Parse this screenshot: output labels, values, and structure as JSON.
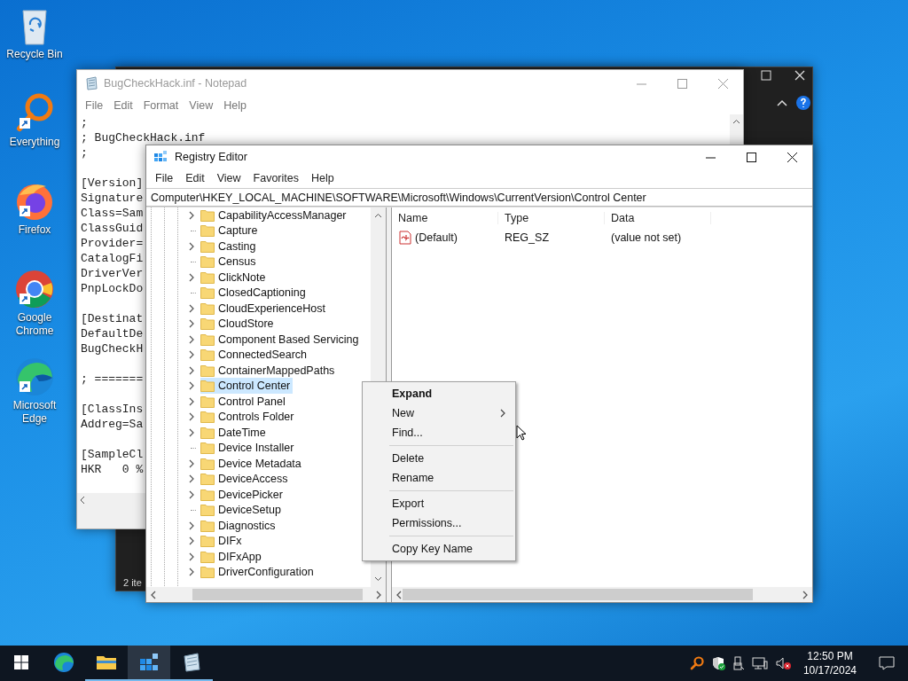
{
  "desktop_icons": [
    {
      "label": "Recycle Bin",
      "kind": "recycle",
      "shortcut": false
    },
    {
      "label": "Everything",
      "kind": "everything",
      "shortcut": true
    },
    {
      "label": "Firefox",
      "kind": "firefox",
      "shortcut": true
    },
    {
      "label": "Google Chrome",
      "kind": "chrome",
      "shortcut": true
    },
    {
      "label": "Microsoft Edge",
      "kind": "edge",
      "shortcut": true
    }
  ],
  "background_window": {
    "status_text": "2 ite"
  },
  "notepad": {
    "title": "BugCheckHack.inf - Notepad",
    "menu": [
      "File",
      "Edit",
      "Format",
      "View",
      "Help"
    ],
    "blocks": [
      [
        ";",
        "; BugCheckHack.inf",
        ";"
      ],
      [
        "[Version]",
        "Signature",
        "Class=Sam",
        "ClassGuid",
        "Provider=",
        "CatalogFi",
        "DriverVer",
        "PnpLockDo"
      ],
      [
        "[Destinat",
        "DefaultDe",
        "BugCheckH"
      ],
      [
        "; ======="
      ],
      [
        "[ClassIns",
        "Addreg=Sa"
      ],
      [
        "[SampleCl",
        "HKR   0 %"
      ]
    ]
  },
  "registry_editor": {
    "title": "Registry Editor",
    "menu": [
      "File",
      "Edit",
      "View",
      "Favorites",
      "Help"
    ],
    "address": "Computer\\HKEY_LOCAL_MACHINE\\SOFTWARE\\Microsoft\\Windows\\CurrentVersion\\Control Center",
    "tree": [
      {
        "label": "CapabilityAccessManager",
        "has_children": true,
        "selected": false
      },
      {
        "label": "Capture",
        "has_children": false,
        "selected": false
      },
      {
        "label": "Casting",
        "has_children": true,
        "selected": false
      },
      {
        "label": "Census",
        "has_children": false,
        "selected": false
      },
      {
        "label": "ClickNote",
        "has_children": true,
        "selected": false
      },
      {
        "label": "ClosedCaptioning",
        "has_children": false,
        "selected": false
      },
      {
        "label": "CloudExperienceHost",
        "has_children": true,
        "selected": false
      },
      {
        "label": "CloudStore",
        "has_children": true,
        "selected": false
      },
      {
        "label": "Component Based Servicing",
        "has_children": true,
        "selected": false
      },
      {
        "label": "ConnectedSearch",
        "has_children": true,
        "selected": false
      },
      {
        "label": "ContainerMappedPaths",
        "has_children": true,
        "selected": false
      },
      {
        "label": "Control Center",
        "has_children": true,
        "selected": true
      },
      {
        "label": "Control Panel",
        "has_children": true,
        "selected": false
      },
      {
        "label": "Controls Folder",
        "has_children": true,
        "selected": false
      },
      {
        "label": "DateTime",
        "has_children": true,
        "selected": false
      },
      {
        "label": "Device Installer",
        "has_children": false,
        "selected": false
      },
      {
        "label": "Device Metadata",
        "has_children": true,
        "selected": false
      },
      {
        "label": "DeviceAccess",
        "has_children": true,
        "selected": false
      },
      {
        "label": "DevicePicker",
        "has_children": true,
        "selected": false
      },
      {
        "label": "DeviceSetup",
        "has_children": false,
        "selected": false
      },
      {
        "label": "Diagnostics",
        "has_children": true,
        "selected": false
      },
      {
        "label": "DIFx",
        "has_children": true,
        "selected": false
      },
      {
        "label": "DIFxApp",
        "has_children": true,
        "selected": false
      },
      {
        "label": "DriverConfiguration",
        "has_children": true,
        "selected": false
      }
    ],
    "columns": [
      "Name",
      "Type",
      "Data"
    ],
    "values": [
      {
        "name": "(Default)",
        "type": "REG_SZ",
        "data": "(value not set)"
      }
    ]
  },
  "context_menu": [
    {
      "kind": "item",
      "label": "Expand",
      "default": true,
      "submenu": false
    },
    {
      "kind": "item",
      "label": "New",
      "default": false,
      "submenu": true
    },
    {
      "kind": "item",
      "label": "Find...",
      "default": false,
      "submenu": false
    },
    {
      "kind": "separator"
    },
    {
      "kind": "item",
      "label": "Delete",
      "default": false,
      "submenu": false
    },
    {
      "kind": "item",
      "label": "Rename",
      "default": false,
      "submenu": false
    },
    {
      "kind": "separator"
    },
    {
      "kind": "item",
      "label": "Export",
      "default": false,
      "submenu": false
    },
    {
      "kind": "item",
      "label": "Permissions...",
      "default": false,
      "submenu": false
    },
    {
      "kind": "separator"
    },
    {
      "kind": "item",
      "label": "Copy Key Name",
      "default": false,
      "submenu": false
    }
  ],
  "taskbar": {
    "apps": [
      {
        "kind": "start",
        "running": false,
        "selected": false
      },
      {
        "kind": "edge",
        "running": false,
        "selected": false
      },
      {
        "kind": "explorer",
        "running": true,
        "selected": false
      },
      {
        "kind": "regedit",
        "running": true,
        "selected": true
      },
      {
        "kind": "notepad",
        "running": true,
        "selected": false
      }
    ],
    "clock": {
      "time": "12:50 PM",
      "date": "10/17/2024"
    }
  }
}
